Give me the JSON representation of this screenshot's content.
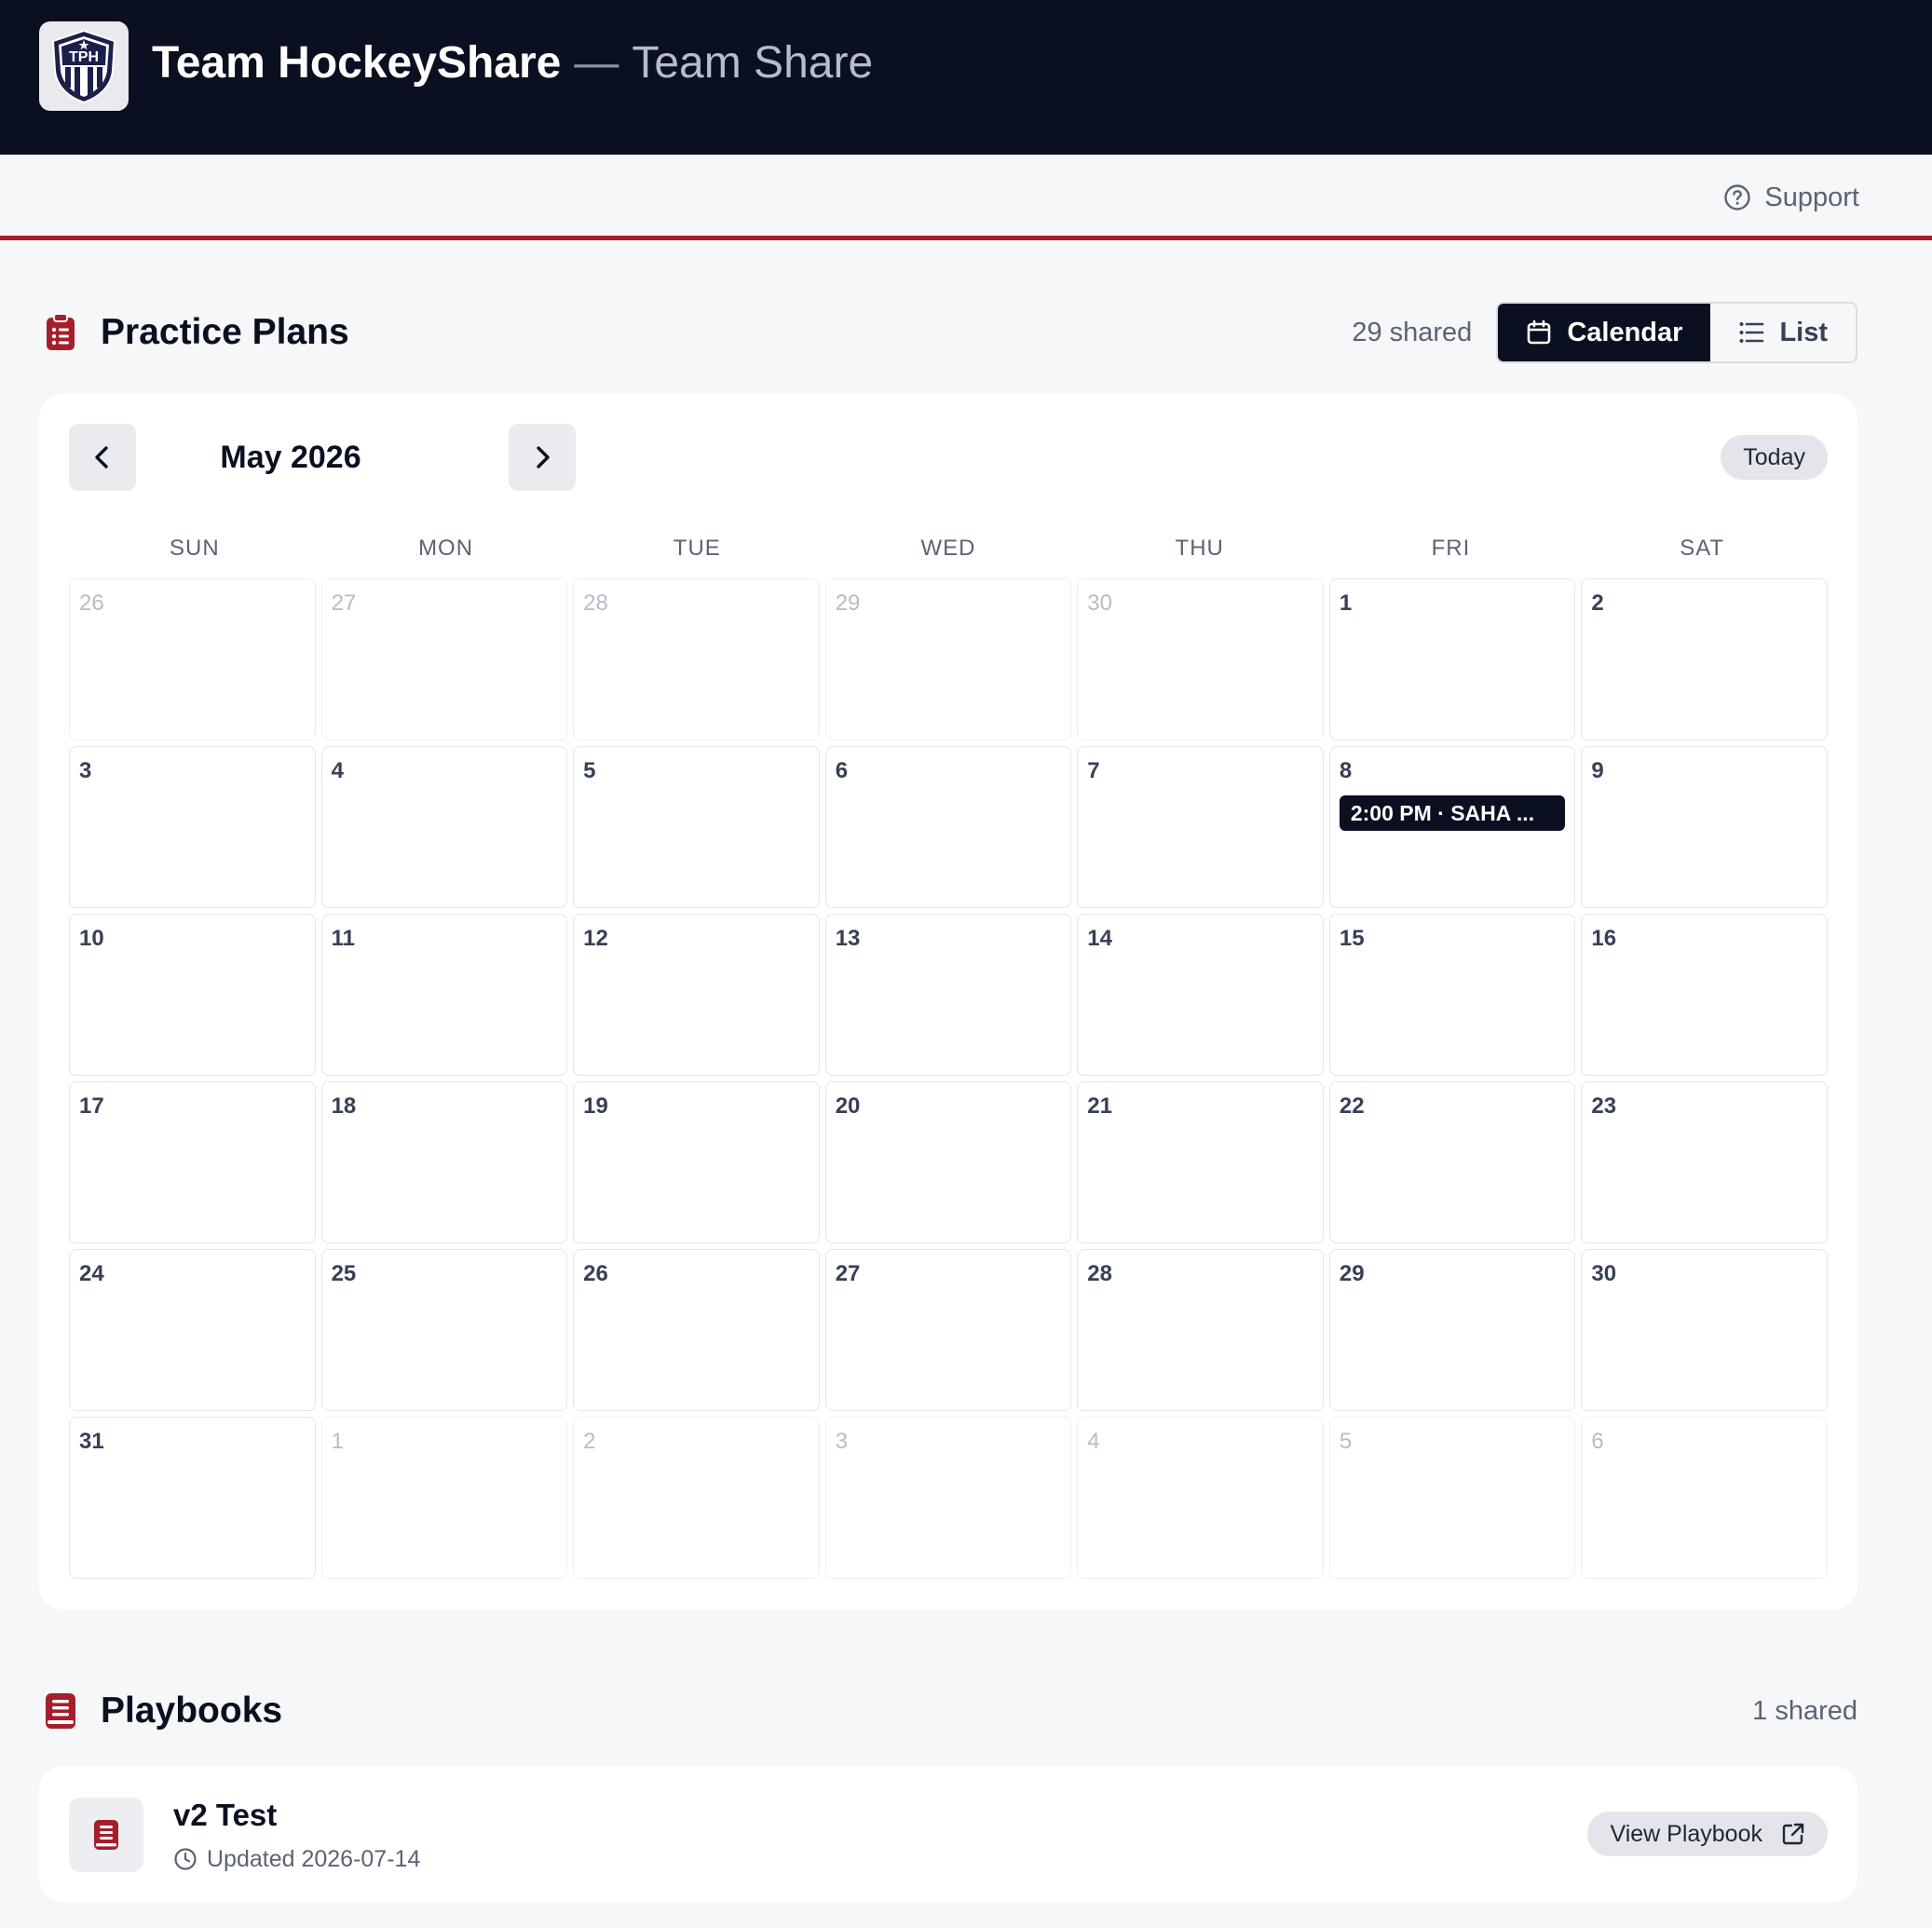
{
  "header": {
    "logo_text": "TPH",
    "brand_name": "Team HockeyShare",
    "separator": "—",
    "subtitle": "Team Share",
    "bg_color": "#0b1020"
  },
  "subbar": {
    "support_label": "Support",
    "accent_color": "#a61e2a"
  },
  "practice_plans": {
    "title": "Practice Plans",
    "icon": "clipboard-list-icon",
    "shared_count": "29 shared",
    "view_toggle": {
      "calendar_label": "Calendar",
      "list_label": "List",
      "active": "Calendar"
    }
  },
  "calendar": {
    "month_label": "May 2026",
    "today_label": "Today",
    "weekdays": [
      "SUN",
      "MON",
      "TUE",
      "WED",
      "THU",
      "FRI",
      "SAT"
    ],
    "weeks": [
      [
        {
          "d": "26",
          "out": true
        },
        {
          "d": "27",
          "out": true
        },
        {
          "d": "28",
          "out": true
        },
        {
          "d": "29",
          "out": true
        },
        {
          "d": "30",
          "out": true
        },
        {
          "d": "1"
        },
        {
          "d": "2"
        }
      ],
      [
        {
          "d": "3"
        },
        {
          "d": "4"
        },
        {
          "d": "5"
        },
        {
          "d": "6"
        },
        {
          "d": "7"
        },
        {
          "d": "8",
          "event": "2:00 PM · SAHA ..."
        },
        {
          "d": "9"
        }
      ],
      [
        {
          "d": "10"
        },
        {
          "d": "11"
        },
        {
          "d": "12"
        },
        {
          "d": "13"
        },
        {
          "d": "14"
        },
        {
          "d": "15"
        },
        {
          "d": "16"
        }
      ],
      [
        {
          "d": "17"
        },
        {
          "d": "18"
        },
        {
          "d": "19"
        },
        {
          "d": "20"
        },
        {
          "d": "21"
        },
        {
          "d": "22"
        },
        {
          "d": "23"
        }
      ],
      [
        {
          "d": "24"
        },
        {
          "d": "25"
        },
        {
          "d": "26"
        },
        {
          "d": "27"
        },
        {
          "d": "28"
        },
        {
          "d": "29"
        },
        {
          "d": "30"
        }
      ],
      [
        {
          "d": "31"
        },
        {
          "d": "1",
          "out": true
        },
        {
          "d": "2",
          "out": true
        },
        {
          "d": "3",
          "out": true
        },
        {
          "d": "4",
          "out": true
        },
        {
          "d": "5",
          "out": true
        },
        {
          "d": "6",
          "out": true
        }
      ]
    ]
  },
  "playbooks": {
    "title": "Playbooks",
    "icon": "book-icon",
    "shared_count": "1 shared",
    "items": [
      {
        "title": "v2 Test",
        "updated": "Updated 2026-07-14",
        "action_label": "View Playbook"
      }
    ]
  }
}
